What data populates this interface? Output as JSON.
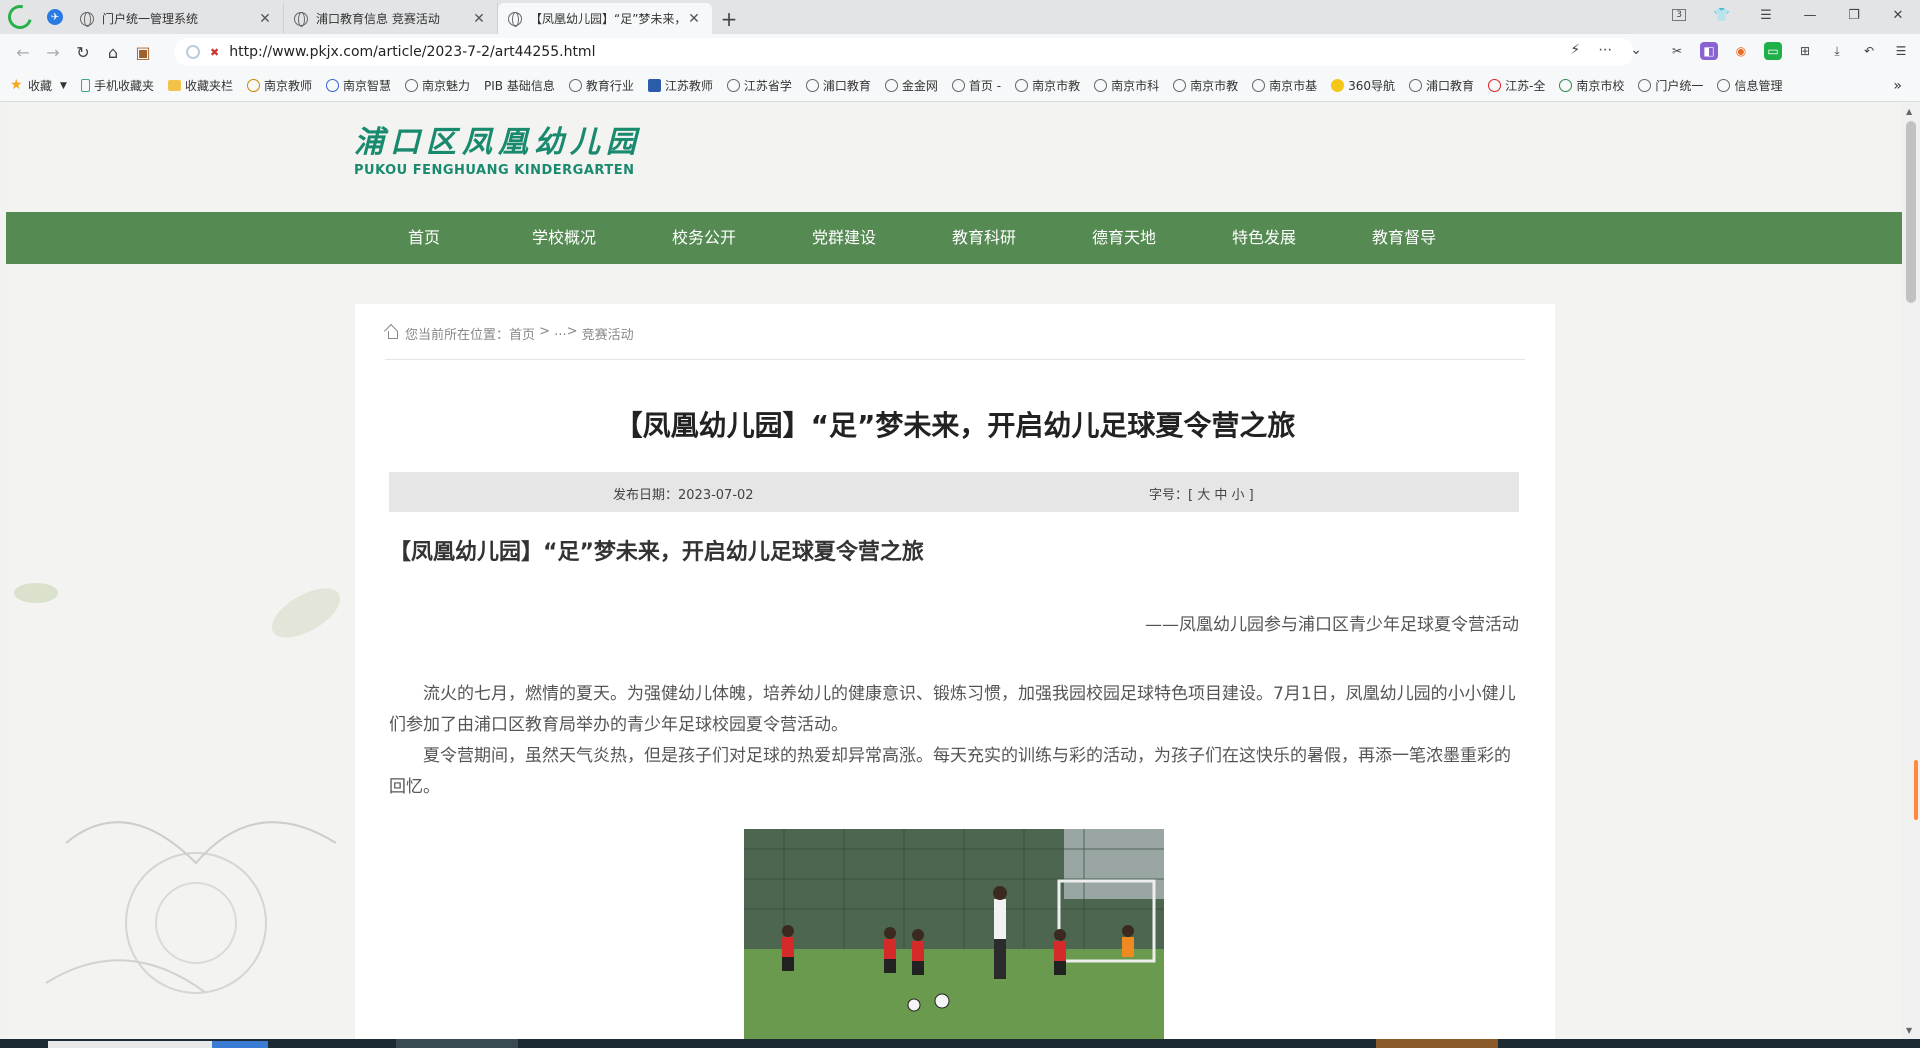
{
  "browser": {
    "pinned_tab_label": "✈",
    "tabs": [
      {
        "title": "门户统一管理系统"
      },
      {
        "title": "浦口教育信息 竞赛活动"
      },
      {
        "title": "【凤凰幼儿园】“足”梦未来，开"
      }
    ],
    "window_badge": "3",
    "address": "http://www.pkjx.com/article/2023-7-2/art44255.html",
    "bookmarks": [
      {
        "label": "收藏",
        "icon": "star-icon"
      },
      {
        "label": "手机收藏夹",
        "icon": "phone-icon"
      },
      {
        "label": "收藏夹栏",
        "icon": "folder-icon"
      },
      {
        "label": "南京教师",
        "icon": "site-icon"
      },
      {
        "label": "南京智慧",
        "icon": "site-icon"
      },
      {
        "label": "南京魅力",
        "icon": "globe-icon"
      },
      {
        "label": "PIB 基础信息",
        "icon": "site-icon"
      },
      {
        "label": "教育行业",
        "icon": "globe-icon"
      },
      {
        "label": "江苏教师",
        "icon": "site-icon"
      },
      {
        "label": "江苏省学",
        "icon": "globe-icon"
      },
      {
        "label": "浦口教育",
        "icon": "globe-icon"
      },
      {
        "label": "金金网",
        "icon": "globe-icon"
      },
      {
        "label": "首页 -",
        "icon": "globe-icon"
      },
      {
        "label": "南京市教",
        "icon": "globe-icon"
      },
      {
        "label": "南京市科",
        "icon": "globe-icon"
      },
      {
        "label": "南京市教",
        "icon": "globe-icon"
      },
      {
        "label": "南京市基",
        "icon": "globe-icon"
      },
      {
        "label": "360导航",
        "icon": "site-icon"
      },
      {
        "label": "浦口教育",
        "icon": "globe-icon"
      },
      {
        "label": "江苏-全",
        "icon": "site-icon"
      },
      {
        "label": "南京市校",
        "icon": "site-icon"
      },
      {
        "label": "门户统一",
        "icon": "globe-icon"
      },
      {
        "label": "信息管理",
        "icon": "globe-icon"
      }
    ]
  },
  "site": {
    "logo_cn": "浦口区凤凰幼儿园",
    "logo_en": "PUKOU FENGHUANG KINDERGARTEN",
    "nav": [
      "首页",
      "学校概况",
      "校务公开",
      "党群建设",
      "教育科研",
      "德育天地",
      "特色发展",
      "教育督导"
    ]
  },
  "breadcrumb": {
    "prefix": "您当前所在位置：",
    "home": "首页",
    "sep1": " > ",
    "ellipsis": "...",
    "sep2": "> ",
    "current": "竞赛活动"
  },
  "article": {
    "title": "【凤凰幼儿园】“足”梦未来，开启幼儿足球夏令营之旅",
    "date_label": "发布日期：2023-07-02",
    "font_size_label": "字号：[ 大 中 小 ]",
    "heading": "【凤凰幼儿园】“足”梦未来，开启幼儿足球夏令营之旅",
    "subtitle": "——凤凰幼儿园参与浦口区青少年足球夏令营活动",
    "paragraphs": [
      "流火的七月，燃情的夏天。为强健幼儿体魄，培养幼儿的健康意识、锻炼习惯，加强我园校园足球特色项目建设。7月1日，凤凰幼儿园的小小健儿们参加了由浦口区教育局举办的青少年足球校园夏令营活动。",
      "夏令营期间，虽然天气炎热，但是孩子们对足球的热爱却异常高涨。每天充实的训练与彩的活动，为孩子们在这快乐的暑假，再添一笔浓墨重彩的回忆。"
    ]
  },
  "colors": {
    "nav_green": "#558a53",
    "logo_teal": "#1a8a6e"
  }
}
